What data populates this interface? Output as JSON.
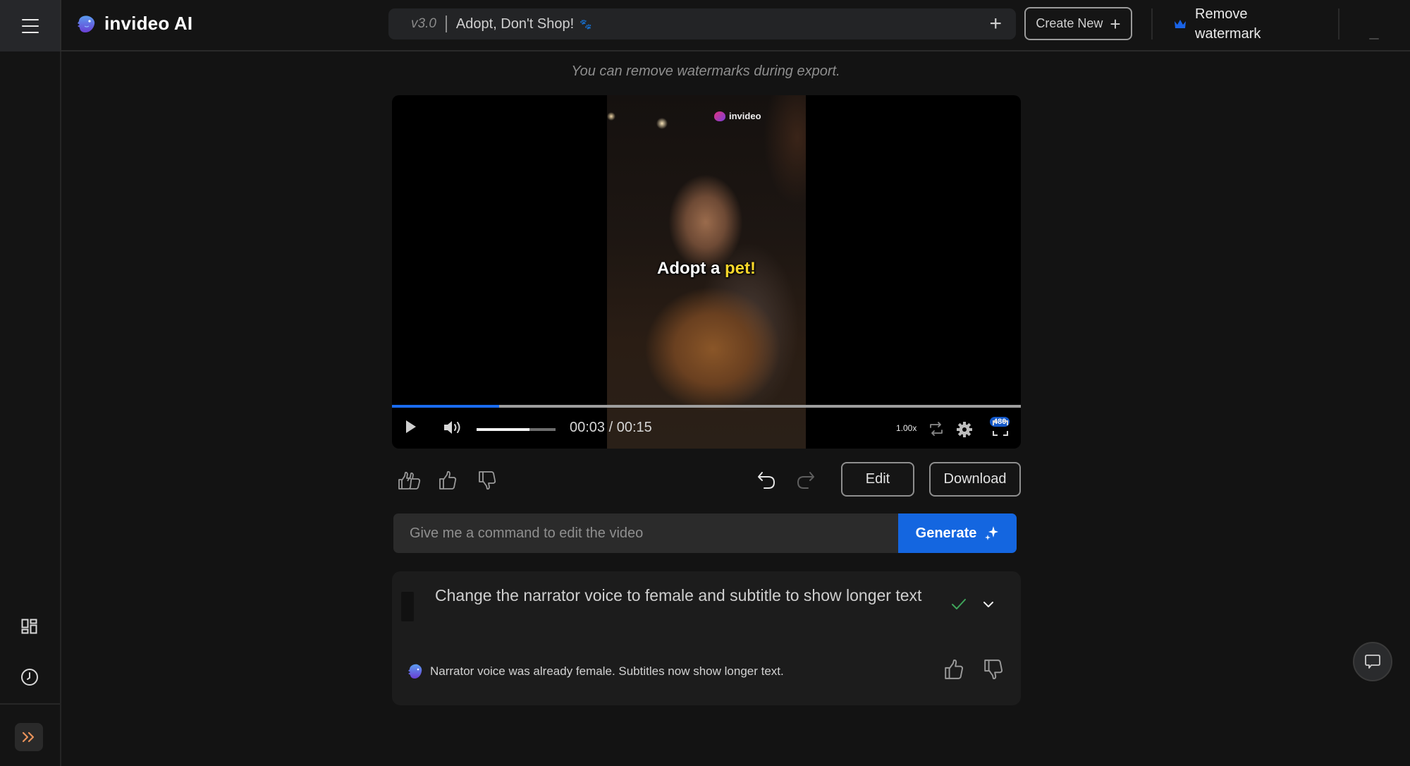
{
  "app": {
    "name": "invideo AI"
  },
  "header": {
    "version": "v3.0",
    "project_title": "Adopt, Don't Shop!",
    "title_emoji": "🐾",
    "create_new_label": "Create New",
    "remove_watermark_label": "Remove watermark"
  },
  "main": {
    "hint": "You can remove watermarks during export.",
    "video": {
      "watermark": "invideo",
      "caption_main": "Adopt a ",
      "caption_highlight": "pet!",
      "current_time": "00:03",
      "duration": "00:15",
      "time_display": "00:03 / 00:15",
      "progress_percent": 17,
      "volume_percent": 67,
      "speed": "1.00x",
      "quality": "480"
    },
    "actions": {
      "edit_label": "Edit",
      "download_label": "Download"
    },
    "command": {
      "placeholder": "Give me a command to edit the video",
      "value": "",
      "generate_label": "Generate"
    },
    "history": [
      {
        "prompt": "Change the narrator voice to female and subtitle to show longer text",
        "status": "done",
        "reply": "Narrator voice was already female. Subtitles now show longer text."
      }
    ]
  },
  "colors": {
    "accent": "#1466e0",
    "progress": "#1a6cf0",
    "success": "#3fa55b",
    "expand_icon": "#e8925a",
    "crown": "#1a63e6"
  }
}
